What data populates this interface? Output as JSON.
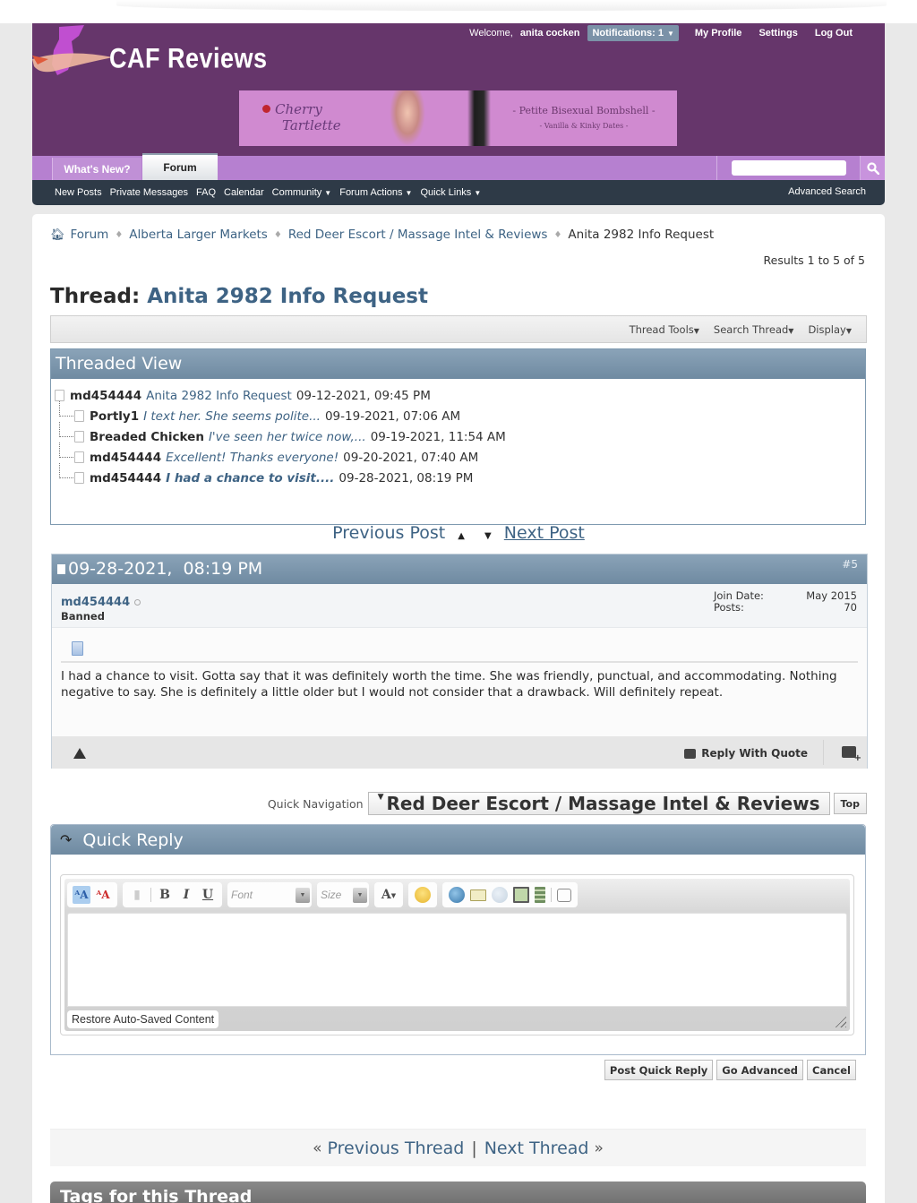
{
  "header": {
    "site_name": "CAF Reviews",
    "welcome_label": "Welcome,",
    "username": "anita cocken",
    "notifications_label": "Notifications: 1",
    "links": [
      "My Profile",
      "Settings",
      "Log Out"
    ],
    "banner": {
      "name_line1": "Cherry",
      "name_line2": "Tartlette",
      "tagline1": "- Petite Bisexual Bombshell -",
      "tagline2": "- Vanilla & Kinky Dates -"
    }
  },
  "tabs": [
    {
      "label": "What's New?",
      "active": false
    },
    {
      "label": "Forum",
      "active": true
    }
  ],
  "search": {
    "placeholder": "",
    "value": ""
  },
  "subnav": {
    "items": [
      {
        "label": "New Posts",
        "dropdown": false
      },
      {
        "label": "Private Messages",
        "dropdown": false
      },
      {
        "label": "FAQ",
        "dropdown": false
      },
      {
        "label": "Calendar",
        "dropdown": false
      },
      {
        "label": "Community",
        "dropdown": true
      },
      {
        "label": "Forum Actions",
        "dropdown": true
      },
      {
        "label": "Quick Links",
        "dropdown": true
      }
    ],
    "advanced_search": "Advanced Search"
  },
  "breadcrumb": [
    "Forum",
    "Alberta Larger Markets",
    "Red Deer Escort / Massage Intel & Reviews",
    "Anita 2982 Info Request"
  ],
  "results_text": "Results 1 to 5 of 5",
  "thread": {
    "prefix": "Thread:",
    "title": "Anita 2982 Info Request",
    "tools": [
      "Thread Tools",
      "Search Thread",
      "Display"
    ]
  },
  "threaded_view": {
    "title": "Threaded View",
    "rows": [
      {
        "author": "md454444",
        "title": "Anita 2982 Info Request",
        "date": "09-12-2021, 09:45 PM",
        "italic": false,
        "current": false
      },
      {
        "author": "Portly1",
        "title": "I text her. She seems polite...",
        "date": "09-19-2021, 07:06 AM",
        "italic": true,
        "current": false
      },
      {
        "author": "Breaded Chicken",
        "title": "I've seen her twice now,...",
        "date": "09-19-2021, 11:54 AM",
        "italic": true,
        "current": false
      },
      {
        "author": "md454444",
        "title": "Excellent! Thanks everyone!",
        "date": "09-20-2021, 07:40 AM",
        "italic": true,
        "current": false
      },
      {
        "author": "md454444",
        "title": "I had a chance to visit....",
        "date": "09-28-2021, 08:19 PM",
        "italic": true,
        "current": true
      }
    ]
  },
  "post_nav": {
    "previous": "Previous Post",
    "next": "Next Post"
  },
  "post": {
    "date": "09-28-2021,  08:19 PM",
    "number": "#5",
    "username": "md454444",
    "user_title": "Banned",
    "join_date_label": "Join Date:",
    "join_date": "May 2015",
    "posts_label": "Posts:",
    "posts": "70",
    "message": "I had a chance to visit. Gotta say that it was definitely worth the time. She was friendly, punctual, and accommodating. Nothing negative to say. She is definitely a little older but I would not consider that a drawback. Will definitely repeat.",
    "reply_with_quote": "Reply With Quote"
  },
  "quick_nav": {
    "label": "Quick Navigation",
    "selected": "Red Deer Escort / Massage Intel & Reviews",
    "top": "Top"
  },
  "quick_reply": {
    "title": "Quick Reply",
    "font_placeholder": "Font",
    "size_placeholder": "Size",
    "restore_label": "Restore Auto-Saved Content",
    "buttons": [
      "Post Quick Reply",
      "Go Advanced",
      "Cancel"
    ]
  },
  "thread_nav": {
    "prev_symbol": "«",
    "previous": "Previous Thread",
    "separator": "|",
    "next": "Next Thread",
    "next_symbol": "»"
  },
  "tags": {
    "title": "Tags for this Thread"
  },
  "colors": {
    "header_bg": "#66366b",
    "tab_bar": "#b680d0",
    "subnav_bg": "#2e3a47",
    "link": "#3e6384",
    "block_head": "#7f97ad"
  }
}
